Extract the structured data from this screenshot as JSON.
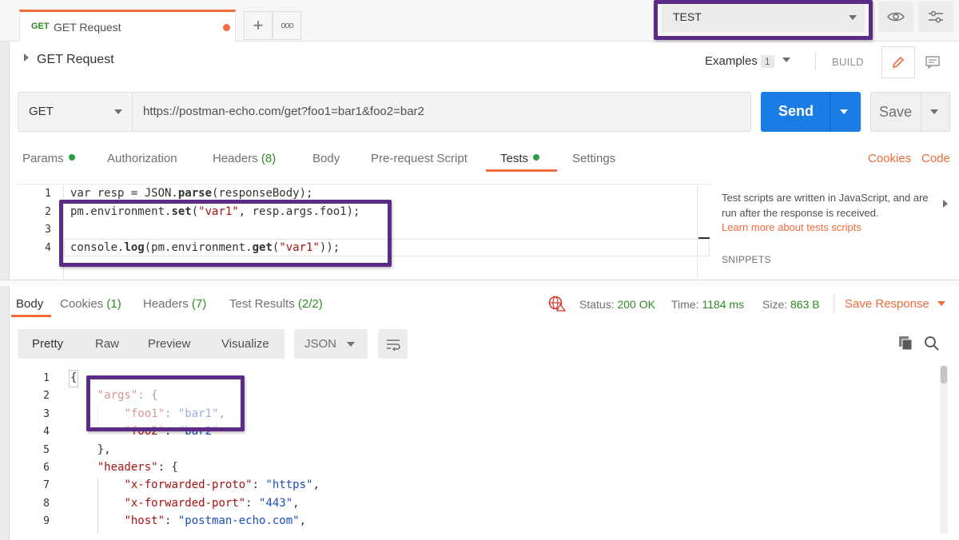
{
  "tabs": {
    "active_tab": {
      "method": "GET",
      "name": "GET Request"
    },
    "new_tab_label": "+",
    "more_tabs_label": "ooo"
  },
  "environment": {
    "selected": "TEST"
  },
  "request": {
    "title": "GET Request",
    "examples_label": "Examples",
    "examples_count": "1",
    "build_label": "BUILD",
    "method": "GET",
    "url": "https://postman-echo.com/get?foo1=bar1&foo2=bar2",
    "send_label": "Send",
    "save_label": "Save"
  },
  "request_tabs": [
    {
      "label": "Params",
      "indicator": "green-dot"
    },
    {
      "label": "Authorization"
    },
    {
      "label": "Headers",
      "count": "(8)"
    },
    {
      "label": "Body"
    },
    {
      "label": "Pre-request Script"
    },
    {
      "label": "Tests",
      "indicator": "green-dot",
      "active": true
    },
    {
      "label": "Settings"
    }
  ],
  "request_links": {
    "cookies": "Cookies",
    "code": "Code"
  },
  "tests_editor": {
    "line_numbers": [
      "1",
      "2",
      "3",
      "4"
    ],
    "lines": [
      {
        "parts": [
          [
            "var resp = JSON.",
            ""
          ],
          [
            "parse",
            "fn"
          ],
          [
            "(responseBody);",
            ""
          ]
        ]
      },
      {
        "parts": [
          [
            "pm.environment.",
            ""
          ],
          [
            "set",
            "fn"
          ],
          [
            "(",
            ""
          ],
          [
            "\"var1\"",
            "str"
          ],
          [
            ", resp.args.foo1);",
            ""
          ]
        ]
      },
      {
        "parts": []
      },
      {
        "parts": [
          [
            "console.",
            ""
          ],
          [
            "log",
            "fn"
          ],
          [
            "(pm.environment.",
            ""
          ],
          [
            "get",
            "fn"
          ],
          [
            "(",
            ""
          ],
          [
            "\"var1\"",
            "str"
          ],
          [
            "));",
            ""
          ]
        ]
      }
    ]
  },
  "side_panel": {
    "help": "Test scripts are written in JavaScript, and are run after the response is received.",
    "link": "Learn more about tests scripts",
    "snippets_label": "SNIPPETS"
  },
  "response_tabs": [
    {
      "label": "Body",
      "active": true
    },
    {
      "label": "Cookies",
      "count": "(1)"
    },
    {
      "label": "Headers",
      "count": "(7)"
    },
    {
      "label": "Test Results",
      "count": "(2/2)"
    }
  ],
  "response_meta": {
    "status_label": "Status:",
    "status_value": "200 OK",
    "time_label": "Time:",
    "time_value": "1184 ms",
    "size_label": "Size:",
    "size_value": "863 B",
    "save_response": "Save Response"
  },
  "response_toolbar": {
    "formats": [
      "Pretty",
      "Raw",
      "Preview",
      "Visualize"
    ],
    "active_format": "Pretty",
    "language": "JSON"
  },
  "response_body": {
    "line_numbers": [
      "1",
      "2",
      "3",
      "4",
      "5",
      "6",
      "7",
      "8",
      "9"
    ],
    "lines": [
      [
        [
          "{",
          ""
        ]
      ],
      [
        [
          "    ",
          ""
        ],
        [
          "\"args\"",
          "key"
        ],
        [
          ": {",
          ""
        ]
      ],
      [
        [
          "        ",
          ""
        ],
        [
          "\"foo1\"",
          "key"
        ],
        [
          ": ",
          ""
        ],
        [
          "\"bar1\"",
          "sval"
        ],
        [
          ",",
          ""
        ]
      ],
      [
        [
          "        ",
          ""
        ],
        [
          "\"foo2\"",
          "key"
        ],
        [
          ": ",
          ""
        ],
        [
          "\"bar2\"",
          "sval"
        ]
      ],
      [
        [
          "    },",
          ""
        ]
      ],
      [
        [
          "    ",
          ""
        ],
        [
          "\"headers\"",
          "key"
        ],
        [
          ": {",
          ""
        ]
      ],
      [
        [
          "        ",
          ""
        ],
        [
          "\"x-forwarded-proto\"",
          "key"
        ],
        [
          ": ",
          ""
        ],
        [
          "\"https\"",
          "sval"
        ],
        [
          ",",
          ""
        ]
      ],
      [
        [
          "        ",
          ""
        ],
        [
          "\"x-forwarded-port\"",
          "key"
        ],
        [
          ": ",
          ""
        ],
        [
          "\"443\"",
          "sval"
        ],
        [
          ",",
          ""
        ]
      ],
      [
        [
          "        ",
          ""
        ],
        [
          "\"host\"",
          "key"
        ],
        [
          ": ",
          ""
        ],
        [
          "\"postman-echo.com\"",
          "sval"
        ],
        [
          ",",
          ""
        ]
      ]
    ]
  },
  "colors": {
    "accent_orange": "#f26b3a",
    "send_blue": "#1a7de6",
    "success_green": "#2e8b23",
    "highlight_purple": "#5c2b86"
  }
}
